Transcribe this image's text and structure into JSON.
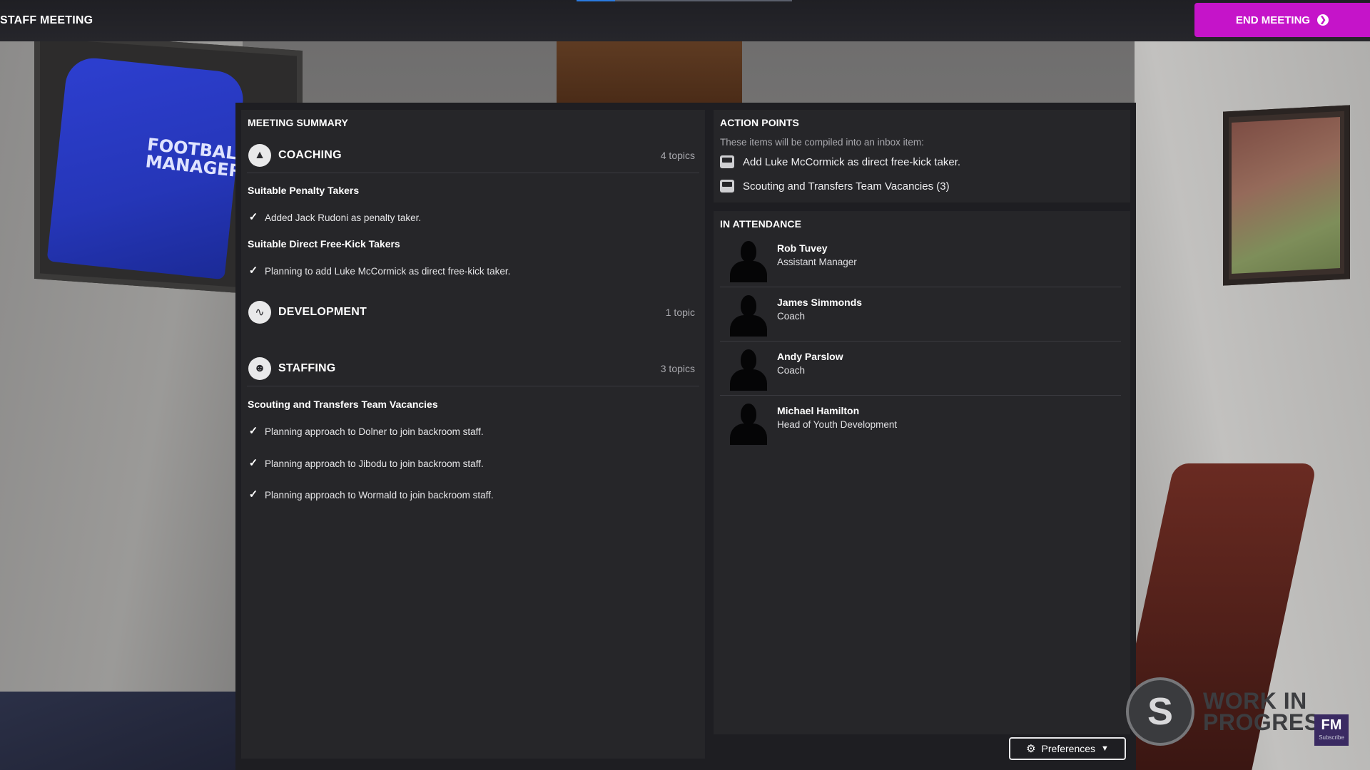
{
  "header": {
    "title": "STAFF MEETING",
    "end_meeting_label": "END MEETING",
    "progress_fraction": 0.18
  },
  "background": {
    "shirt_text": "FOOTBALL MANAGER"
  },
  "summary": {
    "heading": "MEETING SUMMARY",
    "sections": [
      {
        "title": "COACHING",
        "count": "4 topics",
        "icon": "coaching-icon",
        "groups": [
          {
            "heading": "Suitable Penalty Takers",
            "items": [
              "Added Jack Rudoni as penalty taker."
            ]
          },
          {
            "heading": "Suitable Direct Free-Kick Takers",
            "items": [
              "Planning to add Luke McCormick as direct free-kick taker."
            ]
          }
        ]
      },
      {
        "title": "DEVELOPMENT",
        "count": "1 topic",
        "icon": "development-icon",
        "groups": []
      },
      {
        "title": "STAFFING",
        "count": "3 topics",
        "icon": "staffing-icon",
        "groups": [
          {
            "heading": "Scouting and Transfers Team Vacancies",
            "items": [
              "Planning approach to Dolner to join backroom staff.",
              "Planning approach to Jibodu to join backroom staff.",
              "Planning approach to Wormald to join backroom staff."
            ]
          }
        ]
      }
    ]
  },
  "action_points": {
    "heading": "ACTION POINTS",
    "description": "These items will be compiled into an inbox item:",
    "items": [
      "Add Luke McCormick as direct free-kick taker.",
      "Scouting and Transfers Team Vacancies (3)"
    ]
  },
  "attendance": {
    "heading": "IN ATTENDANCE",
    "people": [
      {
        "name": "Rob Tuvey",
        "role": "Assistant Manager"
      },
      {
        "name": "James Simmonds",
        "role": "Coach"
      },
      {
        "name": "Andy Parslow",
        "role": "Coach"
      },
      {
        "name": "Michael Hamilton",
        "role": "Head of Youth Development"
      }
    ]
  },
  "footer": {
    "preferences_label": "Preferences"
  },
  "watermark": {
    "line1": "WORK IN",
    "line2": "PROGRES",
    "badge": "FM",
    "badge_sub": "Subscribe"
  }
}
